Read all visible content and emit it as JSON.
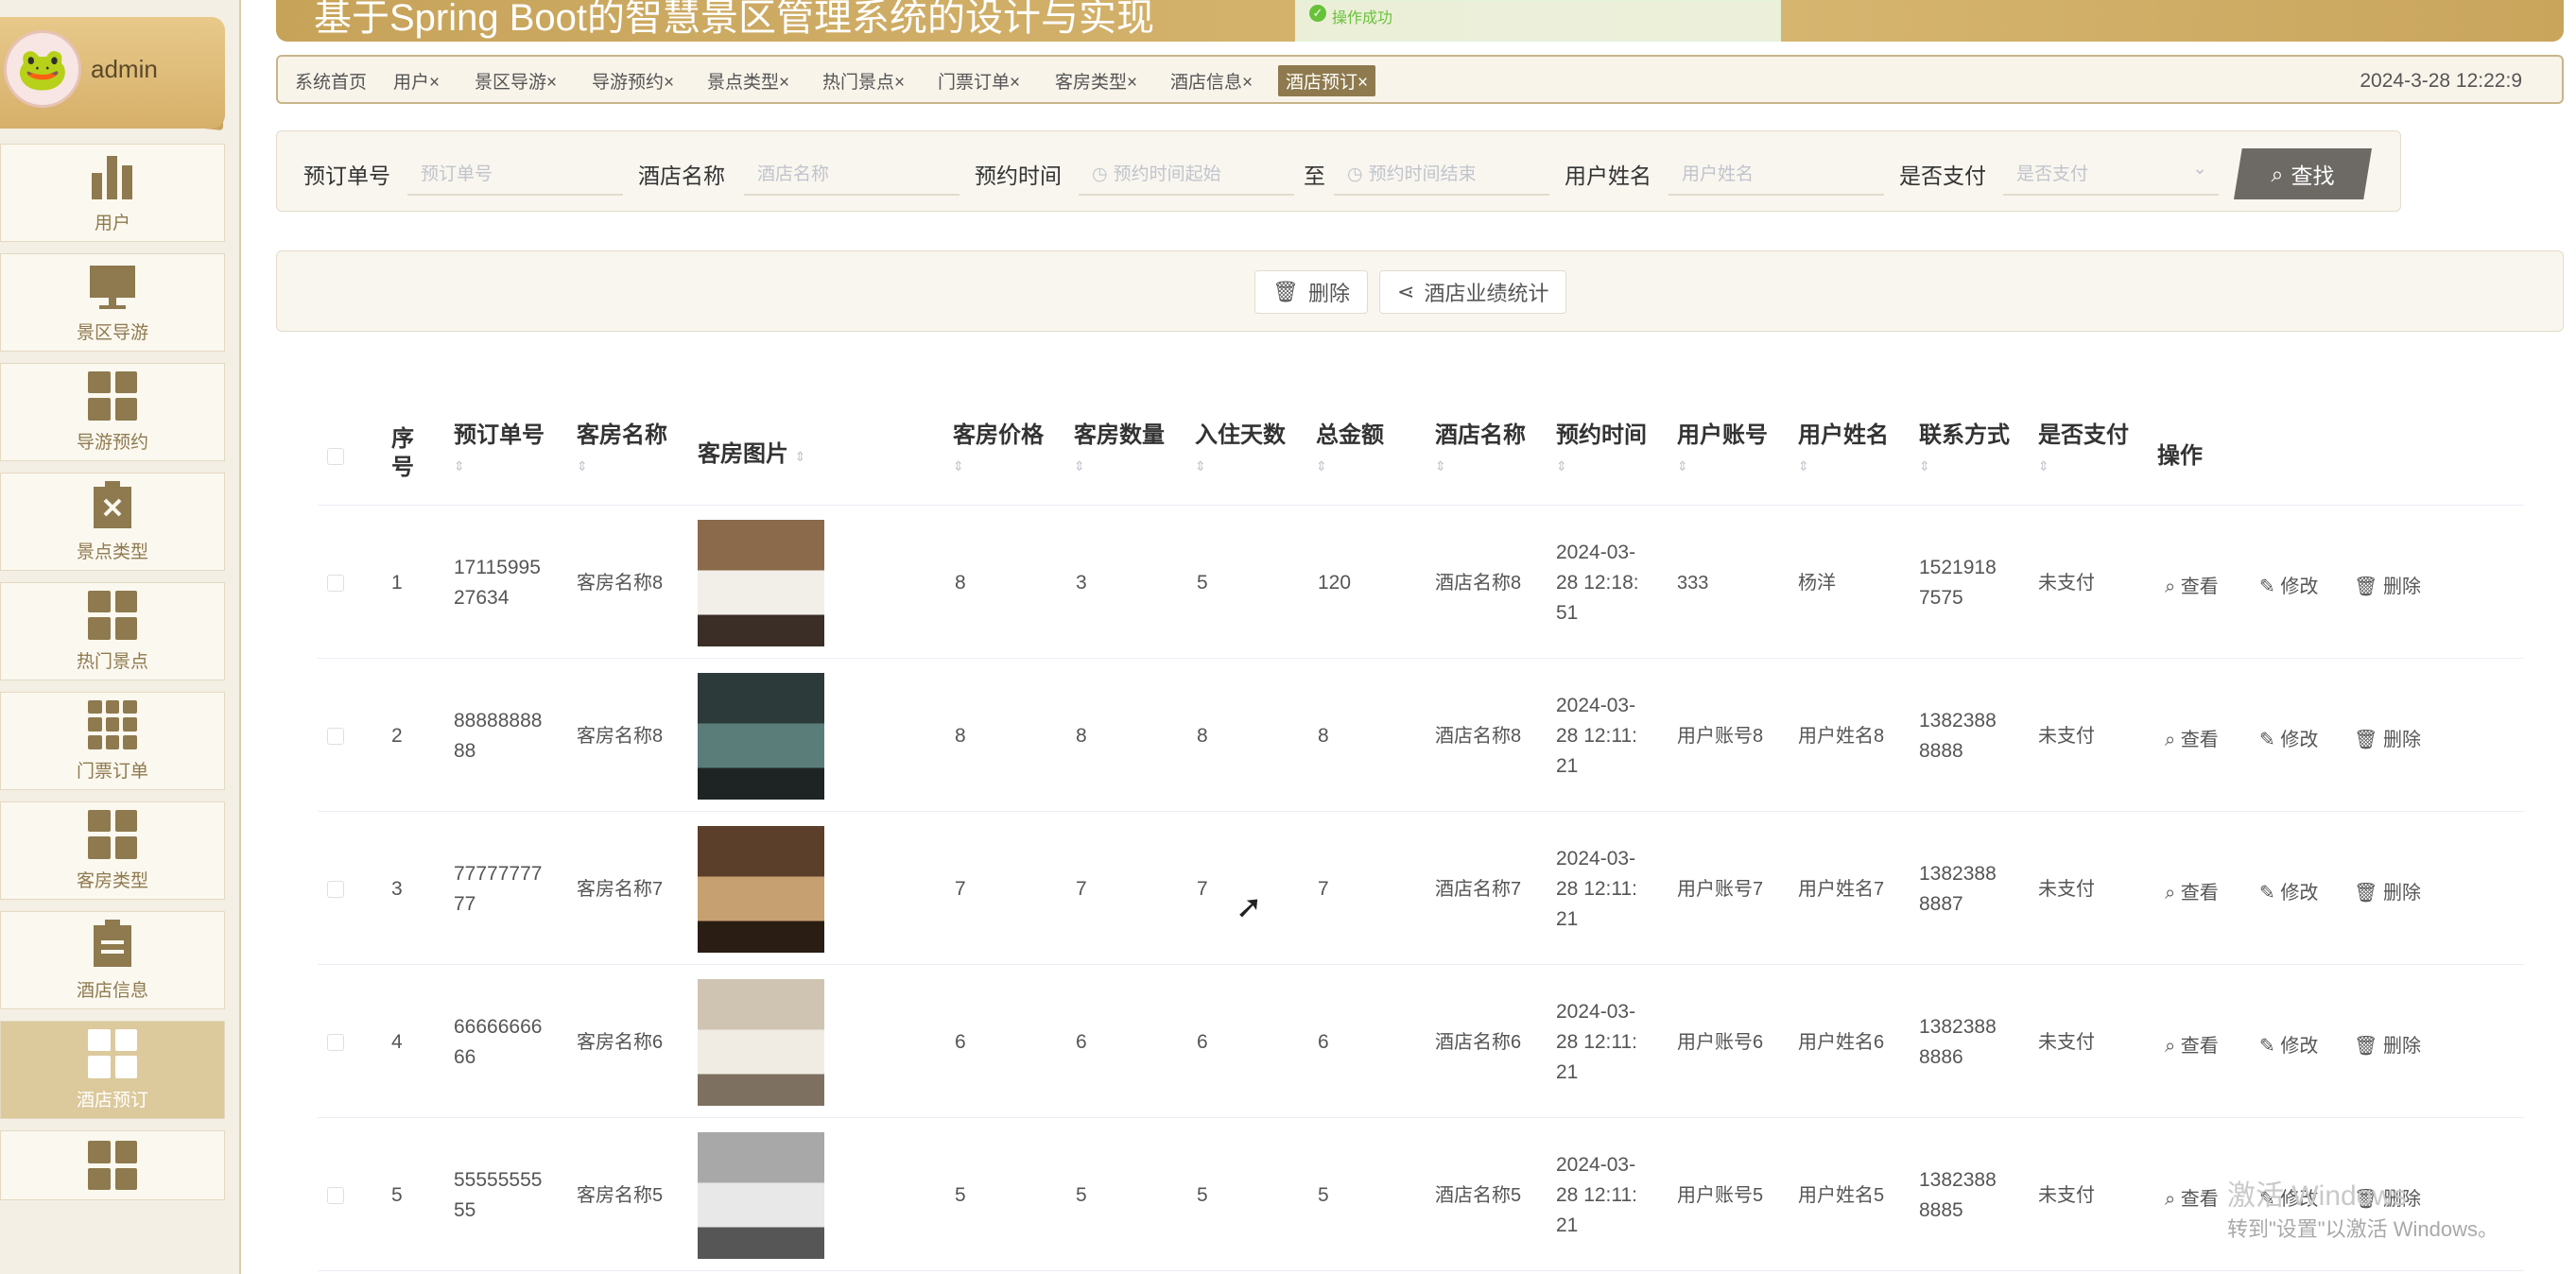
{
  "banner": {
    "title": "基于Spring Boot的智慧景区管理系统的设计与实现",
    "toast": "操作成功"
  },
  "user": {
    "name": "admin"
  },
  "sidebar": {
    "items": [
      {
        "label": "用户"
      },
      {
        "label": "景区导游"
      },
      {
        "label": "导游预约"
      },
      {
        "label": "景点类型"
      },
      {
        "label": "热门景点"
      },
      {
        "label": "门票订单"
      },
      {
        "label": "客房类型"
      },
      {
        "label": "酒店信息"
      },
      {
        "label": "酒店预订"
      },
      {
        "label": ""
      }
    ]
  },
  "tabs": [
    "系统首页",
    "用户×",
    "景区导游×",
    "导游预约×",
    "景点类型×",
    "热门景点×",
    "门票订单×",
    "客房类型×",
    "酒店信息×",
    "酒店预订×"
  ],
  "clock": "2024-3-28 12:22:9",
  "search": {
    "order_label": "预订单号",
    "order_placeholder": "预订单号",
    "hotel_label": "酒店名称",
    "hotel_placeholder": "酒店名称",
    "time_label": "预约时间",
    "time_start_placeholder": "预约时间起始",
    "time_sep": "至",
    "time_end_placeholder": "预约时间结束",
    "name_label": "用户姓名",
    "name_placeholder": "用户姓名",
    "paid_label": "是否支付",
    "paid_placeholder": "是否支付",
    "find_label": "查找"
  },
  "actions": {
    "delete": "删除",
    "stats": "酒店业绩统计"
  },
  "table": {
    "headers": {
      "index": "序号",
      "order": "预订单号",
      "room_name": "客房名称",
      "room_image": "客房图片",
      "price": "客房价格",
      "qty": "客房数量",
      "days": "入住天数",
      "total": "总金额",
      "hotel": "酒店名称",
      "time": "预约时间",
      "account": "用户账号",
      "username": "用户姓名",
      "contact": "联系方式",
      "paid": "是否支付",
      "ops": "操作"
    },
    "ops": {
      "view": "查看",
      "edit": "修改",
      "delete": "删除"
    },
    "rows": [
      {
        "index": "1",
        "order_a": "17115995",
        "order_b": "27634",
        "room_name": "客房名称8",
        "price": "8",
        "qty": "3",
        "days": "5",
        "total": "120",
        "hotel": "酒店名称8",
        "time_a": "2024-03-",
        "time_b": "28 12:18:",
        "time_c": "51",
        "account": "333",
        "username": "杨洋",
        "contact_a": "1521918",
        "contact_b": "7575",
        "paid": "未支付"
      },
      {
        "index": "2",
        "order_a": "88888888",
        "order_b": "88",
        "room_name": "客房名称8",
        "price": "8",
        "qty": "8",
        "days": "8",
        "total": "8",
        "hotel": "酒店名称8",
        "time_a": "2024-03-",
        "time_b": "28 12:11:",
        "time_c": "21",
        "account": "用户账号8",
        "username": "用户姓名8",
        "contact_a": "1382388",
        "contact_b": "8888",
        "paid": "未支付"
      },
      {
        "index": "3",
        "order_a": "77777777",
        "order_b": "77",
        "room_name": "客房名称7",
        "price": "7",
        "qty": "7",
        "days": "7",
        "total": "7",
        "hotel": "酒店名称7",
        "time_a": "2024-03-",
        "time_b": "28 12:11:",
        "time_c": "21",
        "account": "用户账号7",
        "username": "用户姓名7",
        "contact_a": "1382388",
        "contact_b": "8887",
        "paid": "未支付"
      },
      {
        "index": "4",
        "order_a": "66666666",
        "order_b": "66",
        "room_name": "客房名称6",
        "price": "6",
        "qty": "6",
        "days": "6",
        "total": "6",
        "hotel": "酒店名称6",
        "time_a": "2024-03-",
        "time_b": "28 12:11:",
        "time_c": "21",
        "account": "用户账号6",
        "username": "用户姓名6",
        "contact_a": "1382388",
        "contact_b": "8886",
        "paid": "未支付"
      },
      {
        "index": "5",
        "order_a": "55555555",
        "order_b": "55",
        "room_name": "客房名称5",
        "price": "5",
        "qty": "5",
        "days": "5",
        "total": "5",
        "hotel": "酒店名称5",
        "time_a": "2024-03-",
        "time_b": "28 12:11:",
        "time_c": "21",
        "account": "用户账号5",
        "username": "用户姓名5",
        "contact_a": "1382388",
        "contact_b": "8885",
        "paid": "未支付"
      }
    ]
  },
  "watermark": {
    "line1": "激活 Windows",
    "line2": "转到\"设置\"以激活 Windows。"
  }
}
